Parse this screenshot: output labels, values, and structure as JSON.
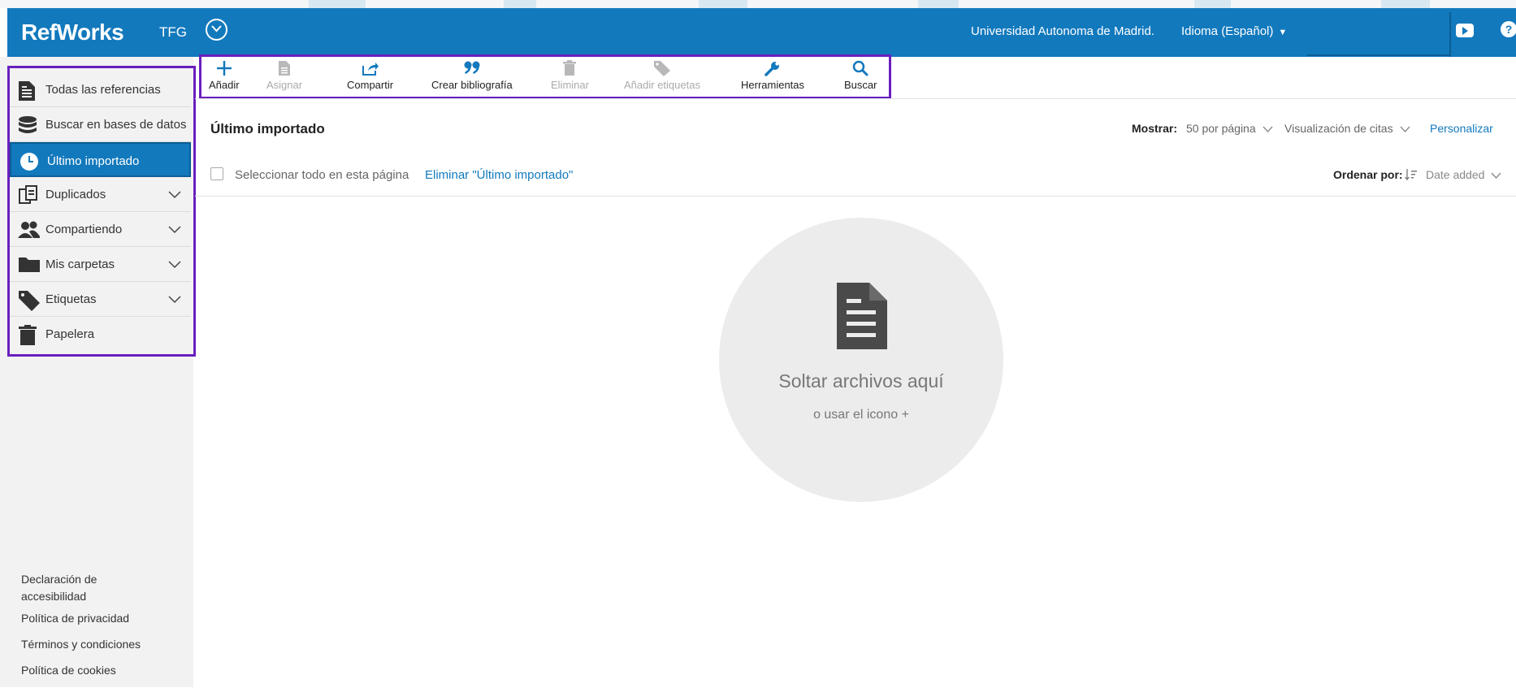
{
  "header": {
    "logo": "RefWorks",
    "project": "TFG",
    "university": "Universidad Autonoma de Madrid.",
    "language": "Idioma (Español)",
    "help_symbol": "?"
  },
  "sidebar": {
    "items": [
      {
        "label": "Todas las referencias",
        "icon": "document-icon"
      },
      {
        "label": "Buscar en bases de datos",
        "icon": "database-icon"
      },
      {
        "label": "Último importado",
        "icon": "clock-icon",
        "active": true
      },
      {
        "label": "Duplicados",
        "icon": "duplicates-icon",
        "expandable": true
      },
      {
        "label": "Compartiendo",
        "icon": "users-icon",
        "expandable": true
      },
      {
        "label": "Mis carpetas",
        "icon": "folder-icon",
        "expandable": true
      },
      {
        "label": "Etiquetas",
        "icon": "tag-icon",
        "expandable": true
      },
      {
        "label": "Papelera",
        "icon": "trash-icon"
      }
    ],
    "footer": [
      "Declaración de accesibilidad",
      "Política de privacidad",
      "Términos y condiciones",
      "Política de cookies"
    ]
  },
  "toolbar": {
    "add": "Añadir",
    "assign": "Asignar",
    "share": "Compartir",
    "bibliography": "Crear bibliografía",
    "delete": "Eliminar",
    "add_tags": "Añadir etiquetas",
    "tools": "Herramientas",
    "search": "Buscar"
  },
  "main": {
    "title": "Último importado",
    "show_label": "Mostrar:",
    "per_page": "50 por página",
    "citation_view": "Visualización de citas",
    "customize": "Personalizar",
    "select_all": "Seleccionar todo en esta página",
    "delete_link": "Eliminar \"Último importado\"",
    "sort_label": "Ordenar por:",
    "sort_value": "Date added",
    "drop_title": "Soltar archivos aquí",
    "drop_subtitle": "o usar el icono +"
  },
  "colors": {
    "header": "#1279bd",
    "highlight_border": "#6a1fbf",
    "link": "#1279bd",
    "sidebar_bg": "#f2f2f2"
  }
}
